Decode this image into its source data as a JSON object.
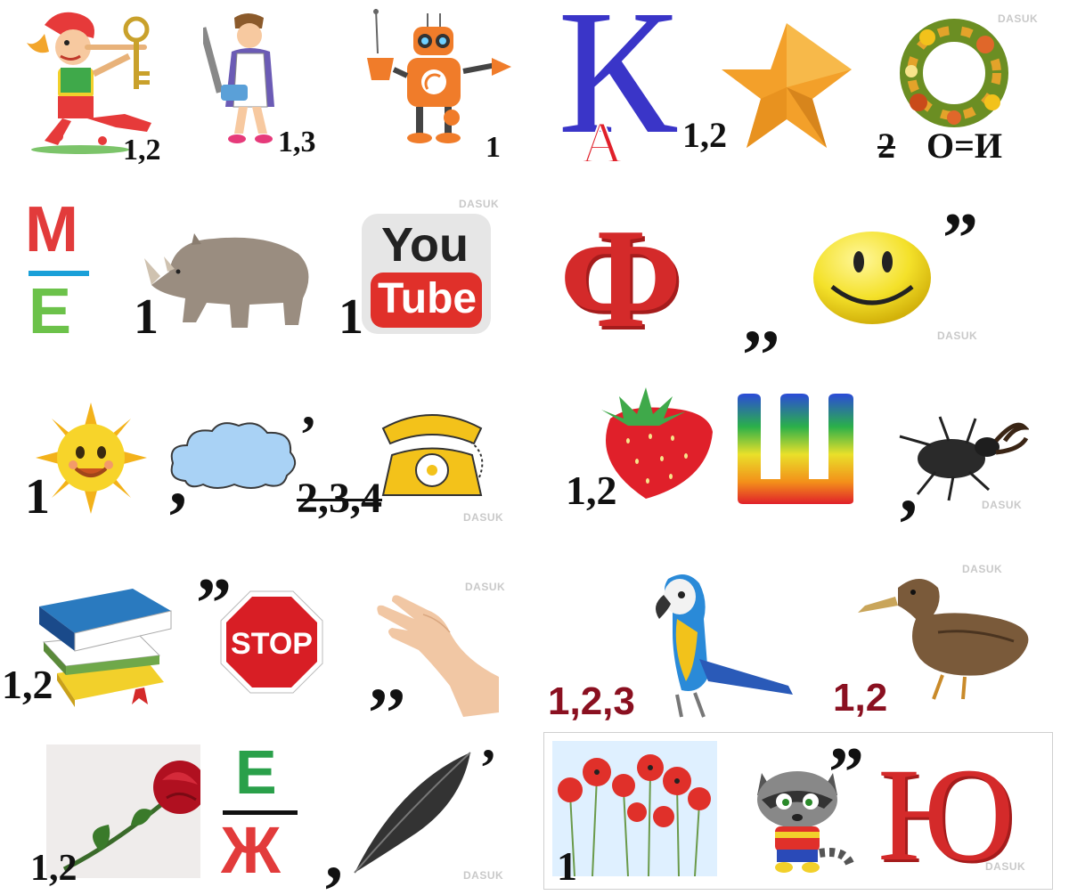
{
  "watermark": "DASUK",
  "puzzles": [
    {
      "id": 1,
      "items": [
        {
          "picture": "buratino-icon",
          "label": "1,2"
        },
        {
          "picture": "cleaning-lady-icon",
          "label": "1,3"
        },
        {
          "picture": "robot-icon",
          "label": "1"
        }
      ]
    },
    {
      "id": 2,
      "items": [
        {
          "picture": "letter-k-with-a-icon",
          "letters": {
            "big": "К",
            "small": "А"
          }
        },
        {
          "picture": "star-icon",
          "label": "1,2"
        },
        {
          "picture": "wreath-icon",
          "label": "2",
          "label_struck": true,
          "replace": "О=И"
        }
      ]
    },
    {
      "id": 3,
      "items": [
        {
          "picture": "fraction-m-over-e-icon",
          "letters": {
            "top": "М",
            "bottom": "Е"
          }
        },
        {
          "picture": "rhino-icon",
          "label": "1"
        },
        {
          "picture": "youtube-icon",
          "label": "1",
          "logo": {
            "top": "You",
            "bottom": "Tube"
          }
        }
      ]
    },
    {
      "id": 4,
      "items": [
        {
          "picture": "letter-f-icon",
          "letter": "Ф"
        },
        {
          "picture": "smiley-icon",
          "quote_before": ",,",
          "quote_after": "”"
        }
      ]
    },
    {
      "id": 5,
      "items": [
        {
          "picture": "sun-icon",
          "label": "1"
        },
        {
          "picture": "cloud-icon",
          "comma_before": ",",
          "comma_after": "’"
        },
        {
          "picture": "telephone-icon",
          "label": "2,3,4",
          "label_struck": true
        }
      ]
    },
    {
      "id": 6,
      "items": [
        {
          "picture": "strawberry-icon",
          "label": "1,2"
        },
        {
          "picture": "letter-sh-icon",
          "letter": "Ш"
        },
        {
          "picture": "stag-beetle-icon",
          "comma_before": ","
        }
      ]
    },
    {
      "id": 7,
      "items": [
        {
          "picture": "books-icon",
          "label": "1,2"
        },
        {
          "picture": "stop-sign-icon",
          "quote_before": "”",
          "sign_text": "STOP"
        },
        {
          "picture": "hand-icon",
          "quote_before": ",,"
        }
      ]
    },
    {
      "id": 8,
      "items": [
        {
          "picture": "parrot-icon",
          "label": "1,2,3"
        },
        {
          "picture": "duck-icon",
          "label": "1,2"
        }
      ]
    },
    {
      "id": 9,
      "items": [
        {
          "picture": "rose-icon",
          "label": "1,2"
        },
        {
          "picture": "fraction-e-over-zh-icon",
          "letters": {
            "top": "Е",
            "bottom": "Ж"
          }
        },
        {
          "picture": "feather-icon",
          "comma_before": ",",
          "comma_after": "’"
        }
      ]
    },
    {
      "id": 10,
      "items": [
        {
          "picture": "poppies-icon",
          "label": "1"
        },
        {
          "picture": "raccoon-icon",
          "quote_after": "”"
        },
        {
          "picture": "letter-yu-icon",
          "letter": "Ю"
        }
      ]
    }
  ],
  "colors": {
    "label_dark": "#111111",
    "label_maroon": "#8a1020",
    "letter_red": "#d42a2a",
    "letter_blue": "#3a35c8",
    "letter_green": "#6cc24a",
    "watermark": "#c9c9c9"
  }
}
